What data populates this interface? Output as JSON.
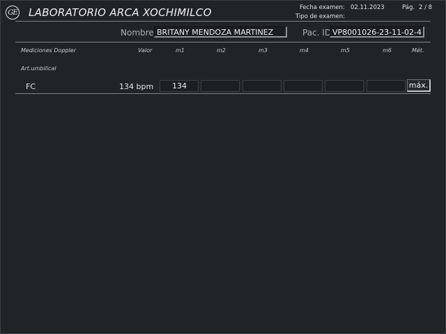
{
  "header": {
    "logo_text": "GE",
    "title": "LABORATORIO ARCA XOCHIMILCO",
    "fecha_label": "Fecha examen:",
    "fecha_value": "02.11.2023",
    "pag_label": "Pág.",
    "pag_value": "2 / 8",
    "tipo_label": "Tipo de examen:"
  },
  "patient": {
    "name_label": "Nombre",
    "name_value": "BRITANY MENDOZA MARTINEZ",
    "id_label": "Pac. ID",
    "id_value": "VP8001026-23-11-02-4"
  },
  "table": {
    "columns": [
      "Mediciones Doppler",
      "Valor",
      "m1",
      "m2",
      "m3",
      "m4",
      "m5",
      "m6",
      "Mét."
    ],
    "section": "Art.umbilical",
    "row": {
      "label": "FC",
      "value": "134 bpm",
      "measurements": [
        "134",
        "",
        "",
        "",
        "",
        ""
      ],
      "method": "máx."
    }
  }
}
